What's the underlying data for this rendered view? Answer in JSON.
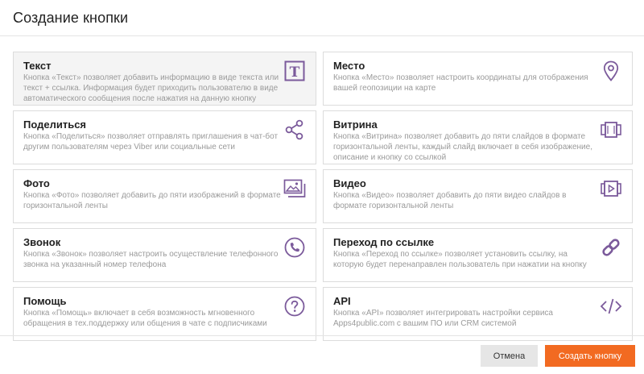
{
  "modal": {
    "title": "Создание кнопки"
  },
  "cards": [
    {
      "title": "Текст",
      "description": "Кнопка «Текст» позволяет добавить информацию в виде текста или текст + ссылка. Информация будет приходить пользователю в виде автоматического сообщения после нажатия на данную кнопку",
      "icon": "text-icon"
    },
    {
      "title": "Место",
      "description": "Кнопка «Место» позволяет настроить координаты для отображения вашей геопозиции на карте",
      "icon": "location-pin-icon"
    },
    {
      "title": "Поделиться",
      "description": "Кнопка «Поделиться» позволяет отправлять приглашения в чат-бот другим пользователям через Viber или социальные сети",
      "icon": "share-icon"
    },
    {
      "title": "Витрина",
      "description": "Кнопка «Витрина» позволяет добавить до пяти слайдов в формате горизонтальной ленты, каждый слайд включает в себя изображение, описание и кнопку со ссылкой",
      "icon": "carousel-icon"
    },
    {
      "title": "Фото",
      "description": "Кнопка «Фото» позволяет добавить до пяти изображений в формате горизонтальной ленты",
      "icon": "photo-icon"
    },
    {
      "title": "Видео",
      "description": "Кнопка «Видео» позволяет добавить до пяти видео слайдов в формате горизонтальной ленты",
      "icon": "video-icon"
    },
    {
      "title": "Звонок",
      "description": "Кнопка «Звонок» позволяет настроить осуществление телефонного звонка на указанный номер телефона",
      "icon": "phone-icon"
    },
    {
      "title": "Переход по ссылке",
      "description": "Кнопка «Переход по ссылке» позволяет установить ссылку, на которую будет перенаправлен пользователь при нажатии на кнопку",
      "icon": "link-icon"
    },
    {
      "title": "Помощь",
      "description": "Кнопка «Помощь» включает в себя возможность мгновенного обращения в тех.поддержку или общения в чате с подписчиками",
      "icon": "help-icon"
    },
    {
      "title": "API",
      "description": "Кнопка «API» позволяет интегрировать настройки сервиса Apps4public.com с вашим ПО или CRM системой",
      "icon": "code-icon"
    }
  ],
  "footer": {
    "cancel_label": "Отмена",
    "create_label": "Создать кнопку"
  },
  "colors": {
    "icon": "#7b5a9b",
    "primary_button": "#f26a21",
    "secondary_button": "#e6e6e6",
    "active_card": "#f4f4f4"
  }
}
